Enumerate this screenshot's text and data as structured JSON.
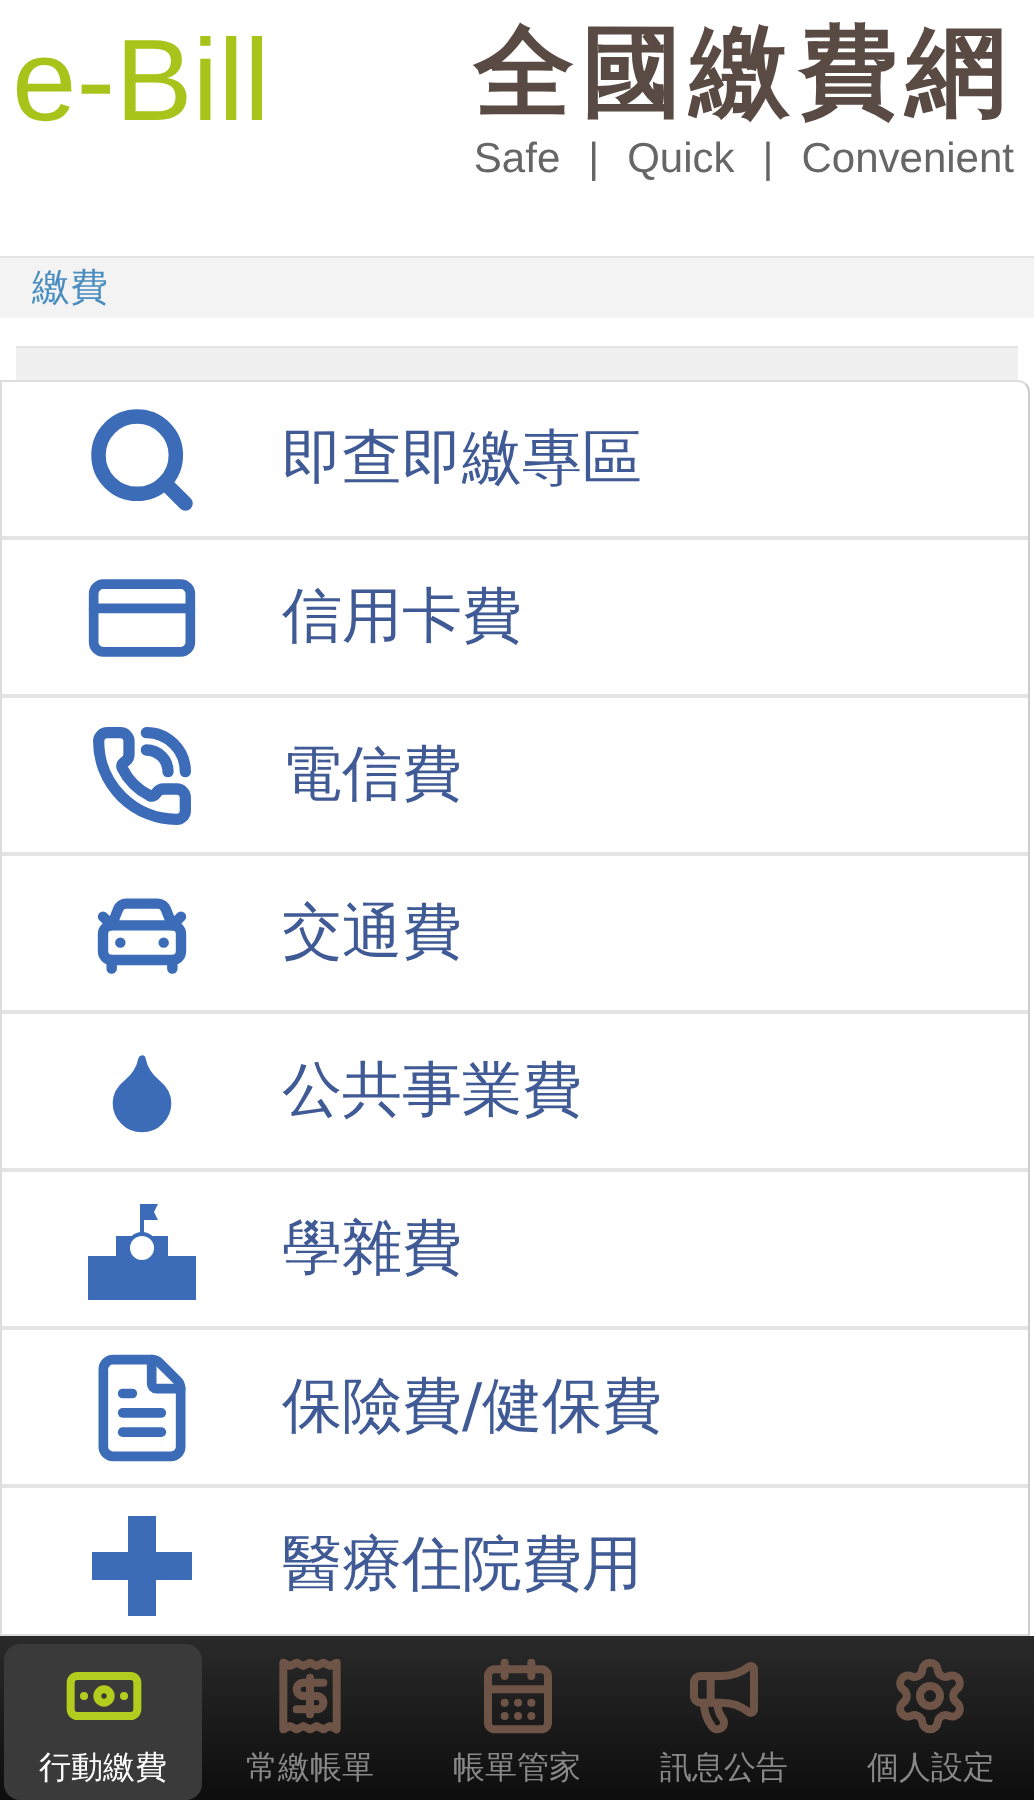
{
  "header": {
    "logo": "e-Bill",
    "title": "全國繳費網",
    "tagline": [
      "Safe",
      "|",
      "Quick",
      "|",
      "Convenient"
    ]
  },
  "breadcrumb": "繳費",
  "menu": [
    {
      "label": "即查即繳專區"
    },
    {
      "label": "信用卡費"
    },
    {
      "label": "電信費"
    },
    {
      "label": "交通費"
    },
    {
      "label": "公共事業費"
    },
    {
      "label": "學雜費"
    },
    {
      "label": "保險費/健保費"
    },
    {
      "label": "醫療住院費用"
    }
  ],
  "tabs": [
    {
      "label": "行動繳費",
      "selected": true
    },
    {
      "label": "常繳帳單",
      "selected": false
    },
    {
      "label": "帳單管家",
      "selected": false
    },
    {
      "label": "訊息公告",
      "selected": false
    },
    {
      "label": "個人設定",
      "selected": false
    }
  ]
}
